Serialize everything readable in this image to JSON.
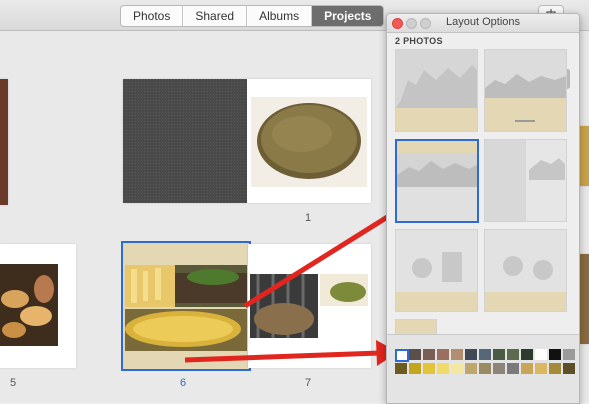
{
  "toolbar": {
    "tabs": [
      {
        "label": "Photos",
        "active": false
      },
      {
        "label": "Shared",
        "active": false
      },
      {
        "label": "Albums",
        "active": false
      },
      {
        "label": "Projects",
        "active": true
      }
    ]
  },
  "pages": [
    {
      "number": "1",
      "selected": false
    },
    {
      "number": "5",
      "selected": false
    },
    {
      "number": "6",
      "selected": true
    },
    {
      "number": "7",
      "selected": false
    }
  ],
  "panel": {
    "title": "Layout Options",
    "section_label": "2 PHOTOS"
  },
  "colors": {
    "accent": "#2e6ad3",
    "beige": "#e3d7b4",
    "toolbar_active": "#6d6d6d",
    "arrow": "#e0261f"
  },
  "swatch_rows": [
    [
      "#ffffff",
      "#5a4f4b",
      "#7a5d55",
      "#9a6f5e",
      "#b08e6e",
      "#3f4a56",
      "#56677a",
      "#4a5b45",
      "#5c6b4f",
      "#2d3b2e",
      "#ffffff",
      "#111111",
      "#9a9a9a"
    ],
    [
      "#6b5b1e",
      "#c4a520",
      "#e2c33a",
      "#efda6a",
      "#f3e7a2",
      "#bda76a",
      "#9a8a63",
      "#8b8477",
      "#7a7a7a",
      "#c9a55a",
      "#d9b860",
      "#a68a3b",
      "#5e4e2a"
    ]
  ]
}
